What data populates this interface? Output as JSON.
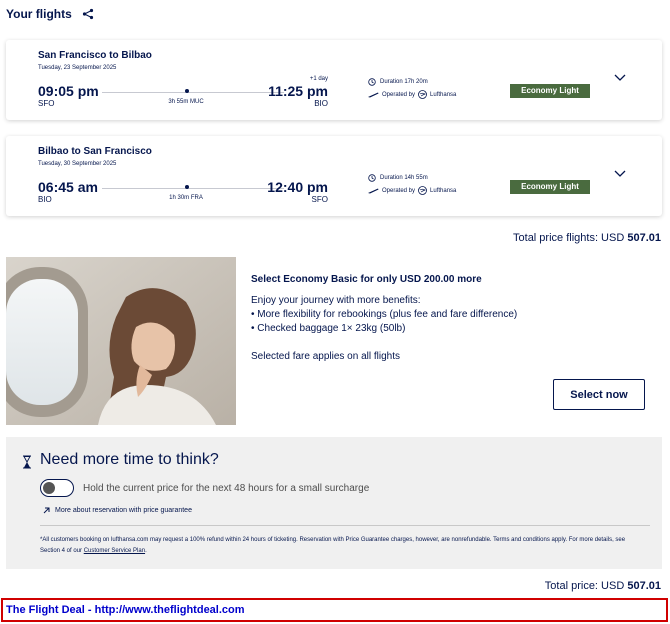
{
  "header": {
    "title": "Your flights"
  },
  "flights": [
    {
      "route": "San Francisco to Bilbao",
      "date": "Tuesday, 23 September 2025",
      "dep_time": "09:05 pm",
      "dep_code": "SFO",
      "stop": "3h 55m MUC",
      "plus_day": "+1 day",
      "arr_time": "11:25 pm",
      "arr_code": "BIO",
      "duration": "Duration 17h 20m",
      "operated_by": "Operated by",
      "airline": "Lufthansa",
      "fare": "Economy Light"
    },
    {
      "route": "Bilbao to San Francisco",
      "date": "Tuesday, 30 September 2025",
      "dep_time": "06:45 am",
      "dep_code": "BIO",
      "stop": "1h 30m FRA",
      "plus_day": "",
      "arr_time": "12:40 pm",
      "arr_code": "SFO",
      "duration": "Duration 14h 55m",
      "operated_by": "Operated by",
      "airline": "Lufthansa",
      "fare": "Economy Light"
    }
  ],
  "total_flights": {
    "label": "Total price flights: USD",
    "value": "507.01"
  },
  "upsell": {
    "title": "Select Economy Basic for only USD 200.00 more",
    "intro": "Enjoy your journey with more benefits:",
    "bullets": [
      "• More flexibility for rebookings (plus fee and fare difference)",
      "• Checked baggage 1× 23kg (50lb)"
    ],
    "note": "Selected fare applies on all flights",
    "button": "Select now"
  },
  "think": {
    "title": "Need more time to think?",
    "toggle_label": "Hold the current price for the next 48 hours for a small surcharge",
    "link": "More about reservation with price guarantee",
    "disclaimer": "*All customers booking on lufthansa.com may request a 100% refund within 24 hours of ticketing. Reservation with Price Guarantee charges, however, are nonrefundable. Terms and conditions apply. For more details, see Section 4 of our",
    "disclaimer_link": "Customer Service Plan",
    "disclaimer_end": "."
  },
  "total_price": {
    "label": "Total price: USD",
    "value": "507.01"
  },
  "footer": {
    "text": "The Flight Deal - http://www.theflightdeal.com"
  },
  "colors": {
    "navy": "#05164d",
    "fare_green": "#4a6b3f",
    "footer_red": "#d00000",
    "footer_blue": "#0000cc"
  }
}
